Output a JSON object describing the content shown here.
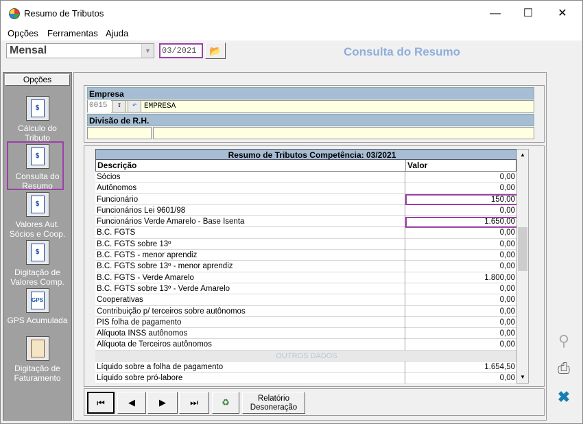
{
  "window": {
    "title": "Resumo de Tributos"
  },
  "menu": [
    "Opções",
    "Ferramentas",
    "Ajuda"
  ],
  "toolbar": {
    "periodo": "Mensal",
    "competencia": "03/2021",
    "header": "Consulta do Resumo"
  },
  "sidebar": {
    "title": "Opções",
    "items": [
      {
        "label": "Cálculo do Tributo",
        "icon": "calc-document-icon"
      },
      {
        "label": "Consulta do Resumo",
        "icon": "consult-computer-icon"
      },
      {
        "label": "Valores Aut. Sócios e  Coop.",
        "icon": "partners-money-icon"
      },
      {
        "label": "Digitação de Valores Comp.",
        "icon": "money-entry-icon"
      },
      {
        "label": "GPS Acumulada",
        "icon": "gps-document-icon"
      },
      {
        "label": "Digitação de Faturamento",
        "icon": "billing-book-icon"
      }
    ]
  },
  "empresa": {
    "label": "Empresa",
    "code": "0015",
    "name": "EMPRESA",
    "divisao_label": "Divisão de R.H."
  },
  "grid": {
    "title": "Resumo de Tributos Competência: 03/2021",
    "col_desc": "Descrição",
    "col_valor": "Valor",
    "rows": [
      {
        "d": "Sócios",
        "v": "0,00"
      },
      {
        "d": "Autônomos",
        "v": "0,00"
      },
      {
        "d": "Funcionário",
        "v": "150,00"
      },
      {
        "d": "Funcionários Lei 9601/98",
        "v": "0,00"
      },
      {
        "d": "Funcionários Verde Amarelo - Base Isenta",
        "v": "1.650,00"
      },
      {
        "d": "B.C. FGTS",
        "v": "0,00"
      },
      {
        "d": "B.C. FGTS sobre 13º",
        "v": "0,00"
      },
      {
        "d": "B.C. FGTS - menor aprendiz",
        "v": "0,00"
      },
      {
        "d": "B.C. FGTS sobre 13º - menor aprendiz",
        "v": "0,00"
      },
      {
        "d": "B.C. FGTS - Verde Amarelo",
        "v": "1.800,00"
      },
      {
        "d": "B.C. FGTS sobre 13º - Verde Amarelo",
        "v": "0,00"
      },
      {
        "d": "Cooperativas",
        "v": "0,00"
      },
      {
        "d": "Contribuição p/ terceiros sobre autônomos",
        "v": "0,00"
      },
      {
        "d": "PIS folha de pagamento",
        "v": "0,00"
      },
      {
        "d": "Alíquota INSS autônomos",
        "v": "0,00"
      },
      {
        "d": "Alíquota de Terceiros autônomos",
        "v": "0,00"
      },
      {
        "d": "OUTROS DADOS",
        "v": "",
        "sep": true
      },
      {
        "d": "Líquido sobre a folha de pagamento",
        "v": "1.654,50"
      },
      {
        "d": "Líquido sobre pró-labore",
        "v": "0,00"
      }
    ]
  },
  "nav": {
    "relatorio": "Relatório Desoneração"
  }
}
